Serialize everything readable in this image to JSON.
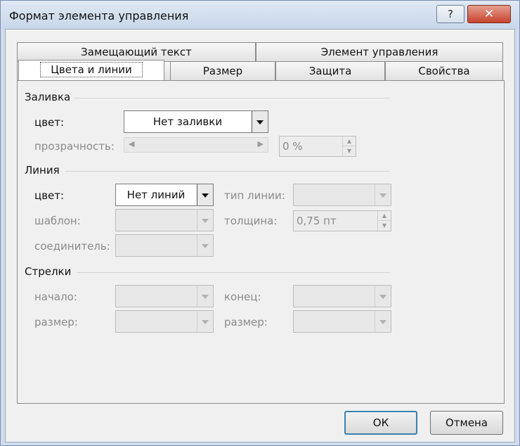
{
  "window": {
    "title": "Формат элемента управления",
    "help": "?",
    "close": "✕"
  },
  "tabs_top": [
    {
      "label": "Замещающий текст"
    },
    {
      "label": "Элемент управления"
    }
  ],
  "tabs_bottom": [
    {
      "label": "Цвета и линии"
    },
    {
      "label": "Размер"
    },
    {
      "label": "Защита"
    },
    {
      "label": "Свойства"
    }
  ],
  "fill": {
    "heading": "Заливка",
    "color_label": "цвет:",
    "color_value": "Нет заливки",
    "transparency_label": "прозрачность:",
    "transparency_value": "0 %"
  },
  "line": {
    "heading": "Линия",
    "color_label": "цвет:",
    "color_value": "Нет линий",
    "type_label": "тип линии:",
    "pattern_label": "шаблон:",
    "weight_label": "толщина:",
    "weight_value": "0,75 пт",
    "connector_label": "соединитель:"
  },
  "arrows": {
    "heading": "Стрелки",
    "begin_label": "начало:",
    "end_label": "конец:",
    "begin_size_label": "размер:",
    "end_size_label": "размер:"
  },
  "buttons": {
    "ok": "ОК",
    "cancel": "Отмена"
  }
}
